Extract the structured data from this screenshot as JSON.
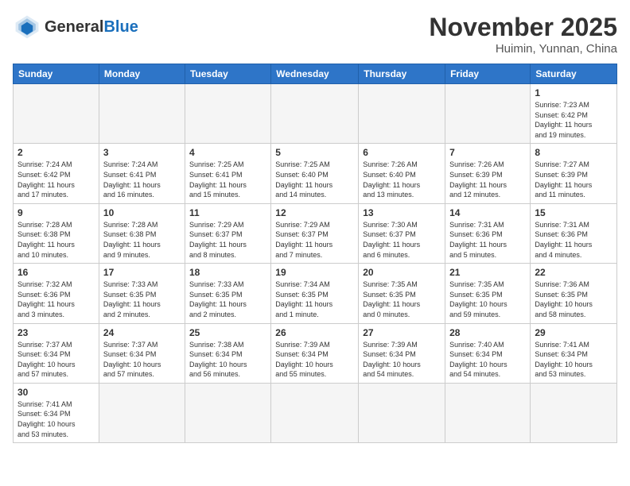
{
  "header": {
    "logo_general": "General",
    "logo_blue": "Blue",
    "title": "November 2025",
    "subtitle": "Huimin, Yunnan, China"
  },
  "weekdays": [
    "Sunday",
    "Monday",
    "Tuesday",
    "Wednesday",
    "Thursday",
    "Friday",
    "Saturday"
  ],
  "weeks": [
    [
      {
        "day": "",
        "info": ""
      },
      {
        "day": "",
        "info": ""
      },
      {
        "day": "",
        "info": ""
      },
      {
        "day": "",
        "info": ""
      },
      {
        "day": "",
        "info": ""
      },
      {
        "day": "",
        "info": ""
      },
      {
        "day": "1",
        "info": "Sunrise: 7:23 AM\nSunset: 6:42 PM\nDaylight: 11 hours\nand 19 minutes."
      }
    ],
    [
      {
        "day": "2",
        "info": "Sunrise: 7:24 AM\nSunset: 6:42 PM\nDaylight: 11 hours\nand 17 minutes."
      },
      {
        "day": "3",
        "info": "Sunrise: 7:24 AM\nSunset: 6:41 PM\nDaylight: 11 hours\nand 16 minutes."
      },
      {
        "day": "4",
        "info": "Sunrise: 7:25 AM\nSunset: 6:41 PM\nDaylight: 11 hours\nand 15 minutes."
      },
      {
        "day": "5",
        "info": "Sunrise: 7:25 AM\nSunset: 6:40 PM\nDaylight: 11 hours\nand 14 minutes."
      },
      {
        "day": "6",
        "info": "Sunrise: 7:26 AM\nSunset: 6:40 PM\nDaylight: 11 hours\nand 13 minutes."
      },
      {
        "day": "7",
        "info": "Sunrise: 7:26 AM\nSunset: 6:39 PM\nDaylight: 11 hours\nand 12 minutes."
      },
      {
        "day": "8",
        "info": "Sunrise: 7:27 AM\nSunset: 6:39 PM\nDaylight: 11 hours\nand 11 minutes."
      }
    ],
    [
      {
        "day": "9",
        "info": "Sunrise: 7:28 AM\nSunset: 6:38 PM\nDaylight: 11 hours\nand 10 minutes."
      },
      {
        "day": "10",
        "info": "Sunrise: 7:28 AM\nSunset: 6:38 PM\nDaylight: 11 hours\nand 9 minutes."
      },
      {
        "day": "11",
        "info": "Sunrise: 7:29 AM\nSunset: 6:37 PM\nDaylight: 11 hours\nand 8 minutes."
      },
      {
        "day": "12",
        "info": "Sunrise: 7:29 AM\nSunset: 6:37 PM\nDaylight: 11 hours\nand 7 minutes."
      },
      {
        "day": "13",
        "info": "Sunrise: 7:30 AM\nSunset: 6:37 PM\nDaylight: 11 hours\nand 6 minutes."
      },
      {
        "day": "14",
        "info": "Sunrise: 7:31 AM\nSunset: 6:36 PM\nDaylight: 11 hours\nand 5 minutes."
      },
      {
        "day": "15",
        "info": "Sunrise: 7:31 AM\nSunset: 6:36 PM\nDaylight: 11 hours\nand 4 minutes."
      }
    ],
    [
      {
        "day": "16",
        "info": "Sunrise: 7:32 AM\nSunset: 6:36 PM\nDaylight: 11 hours\nand 3 minutes."
      },
      {
        "day": "17",
        "info": "Sunrise: 7:33 AM\nSunset: 6:35 PM\nDaylight: 11 hours\nand 2 minutes."
      },
      {
        "day": "18",
        "info": "Sunrise: 7:33 AM\nSunset: 6:35 PM\nDaylight: 11 hours\nand 2 minutes."
      },
      {
        "day": "19",
        "info": "Sunrise: 7:34 AM\nSunset: 6:35 PM\nDaylight: 11 hours\nand 1 minute."
      },
      {
        "day": "20",
        "info": "Sunrise: 7:35 AM\nSunset: 6:35 PM\nDaylight: 11 hours\nand 0 minutes."
      },
      {
        "day": "21",
        "info": "Sunrise: 7:35 AM\nSunset: 6:35 PM\nDaylight: 10 hours\nand 59 minutes."
      },
      {
        "day": "22",
        "info": "Sunrise: 7:36 AM\nSunset: 6:35 PM\nDaylight: 10 hours\nand 58 minutes."
      }
    ],
    [
      {
        "day": "23",
        "info": "Sunrise: 7:37 AM\nSunset: 6:34 PM\nDaylight: 10 hours\nand 57 minutes."
      },
      {
        "day": "24",
        "info": "Sunrise: 7:37 AM\nSunset: 6:34 PM\nDaylight: 10 hours\nand 57 minutes."
      },
      {
        "day": "25",
        "info": "Sunrise: 7:38 AM\nSunset: 6:34 PM\nDaylight: 10 hours\nand 56 minutes."
      },
      {
        "day": "26",
        "info": "Sunrise: 7:39 AM\nSunset: 6:34 PM\nDaylight: 10 hours\nand 55 minutes."
      },
      {
        "day": "27",
        "info": "Sunrise: 7:39 AM\nSunset: 6:34 PM\nDaylight: 10 hours\nand 54 minutes."
      },
      {
        "day": "28",
        "info": "Sunrise: 7:40 AM\nSunset: 6:34 PM\nDaylight: 10 hours\nand 54 minutes."
      },
      {
        "day": "29",
        "info": "Sunrise: 7:41 AM\nSunset: 6:34 PM\nDaylight: 10 hours\nand 53 minutes."
      }
    ],
    [
      {
        "day": "30",
        "info": "Sunrise: 7:41 AM\nSunset: 6:34 PM\nDaylight: 10 hours\nand 53 minutes."
      },
      {
        "day": "",
        "info": ""
      },
      {
        "day": "",
        "info": ""
      },
      {
        "day": "",
        "info": ""
      },
      {
        "day": "",
        "info": ""
      },
      {
        "day": "",
        "info": ""
      },
      {
        "day": "",
        "info": ""
      }
    ]
  ]
}
